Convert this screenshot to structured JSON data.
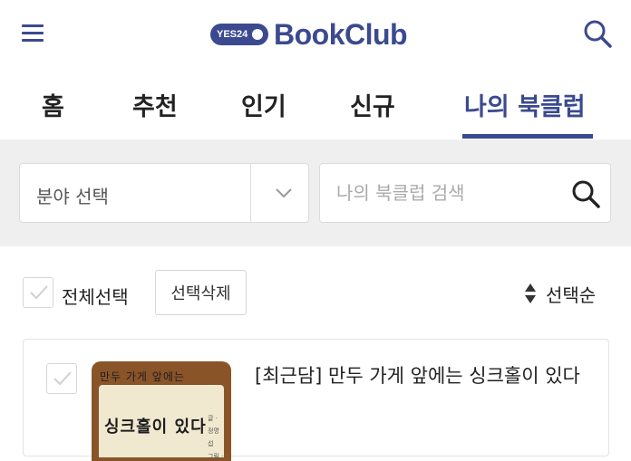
{
  "header": {
    "logo_badge": "YES24",
    "logo_text": "BookClub",
    "menu_icon": "hamburger-menu-icon",
    "search_icon": "search-icon"
  },
  "tabs": [
    {
      "label": "홈",
      "active": false
    },
    {
      "label": "추천",
      "active": false
    },
    {
      "label": "인기",
      "active": false
    },
    {
      "label": "신규",
      "active": false
    },
    {
      "label": "나의 북클럽",
      "active": true
    }
  ],
  "filters": {
    "category_select": "분야 선택",
    "search_placeholder": "나의 북클럽 검색"
  },
  "actions": {
    "select_all_label": "전체선택",
    "delete_selected_label": "선택삭제",
    "sort_label": "선택순"
  },
  "books": [
    {
      "title": "[최근담] 만두 가게 앞에는 싱크홀이 있다",
      "cover_title_line1": "만두 가게 앞에는",
      "cover_title_line2": "싱크홀이 있다",
      "cover_meta_line1": "글 · 정명섭",
      "cover_meta_line2": "그림 · 조화"
    }
  ],
  "colors": {
    "brand": "#3b4a8f",
    "filter_bg": "#efefef",
    "cover": "#8a5429"
  }
}
